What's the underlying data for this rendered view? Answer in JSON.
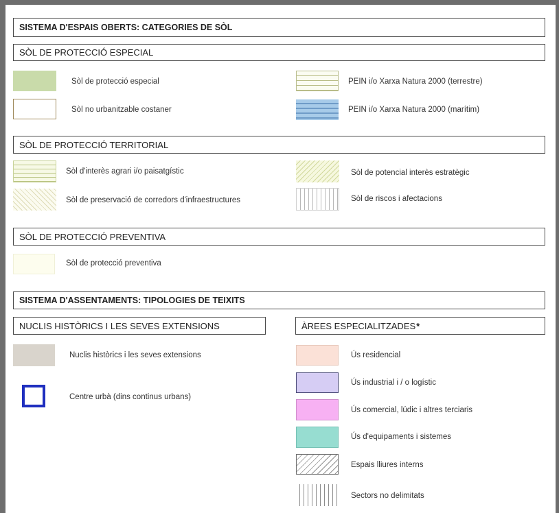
{
  "sections": {
    "espais_oberts": {
      "title": "SISTEMA D'ESPAIS OBERTS: CATEGORIES DE SÒL"
    },
    "proteccio_especial": {
      "title": "SÒL DE PROTECCIÓ ESPECIAL",
      "items": [
        {
          "label": "Sòl de protecció especial",
          "swatch": "solid-green",
          "color": "#c9dbaa"
        },
        {
          "label": "Sòl no urbanitzable costaner",
          "swatch": "outlined-box",
          "color": "#a08a5c"
        },
        {
          "label": "PEIN i/o Xarxa Natura 2000 (terrestre)",
          "swatch": "horizontal-lines",
          "color": "#b8bc85"
        },
        {
          "label": "PEIN i/o Xarxa Natura 2000 (marítim)",
          "swatch": "blue-horizontal-lines",
          "color": "#a7cbe9"
        }
      ]
    },
    "proteccio_territorial": {
      "title": "SÒL DE PROTECCIÓ TERRITORIAL",
      "items": [
        {
          "label": "Sòl d'interès agrari i/o paisatgístic",
          "swatch": "horizontal-lines",
          "color": "#b9c481"
        },
        {
          "label": "Sòl de preservació de corredors d'infraestructures",
          "swatch": "diagonal-hatch",
          "color": "#dedbb6"
        },
        {
          "label": "Sòl de potencial interès estratègic",
          "swatch": "diagonal-hatch",
          "color": "#d1d89c"
        },
        {
          "label": "Sòl de riscos i afectacions",
          "swatch": "vertical-lines",
          "color": "#b8b8b8"
        }
      ]
    },
    "proteccio_preventiva": {
      "title": "SÒL DE PROTECCIÓ PREVENTIVA",
      "items": [
        {
          "label": "Sòl de protecció preventiva",
          "swatch": "pale-yellow",
          "color": "#fdfdee"
        }
      ]
    },
    "assentaments": {
      "title": "SISTEMA D'ASSENTAMENTS: TIPOLOGIES DE TEIXITS"
    },
    "nuclis": {
      "title": "NUCLIS HISTÒRICS I LES SEVES EXTENSIONS",
      "items": [
        {
          "label": "Nuclis històrics i les seves extensions",
          "swatch": "solid-grey",
          "color": "#d9d4cc"
        },
        {
          "label": "Centre urbà (dins continus urbans)",
          "swatch": "blue-square-outline",
          "color": "#1f2fbf"
        }
      ]
    },
    "arees": {
      "title": "ÀREES ESPECIALITZADES",
      "title_mark": "*",
      "items": [
        {
          "label": "Ús residencial",
          "swatch": "solid-peach",
          "color": "#fbe1d7"
        },
        {
          "label": "Ús industrial i / o logístic",
          "swatch": "solid-lavender",
          "color": "#d6cdf4"
        },
        {
          "label": "Ús comercial, lúdic i altres terciaris",
          "swatch": "solid-pink",
          "color": "#f7b1f3"
        },
        {
          "label": "Ús d'equipaments i sistemes",
          "swatch": "solid-teal",
          "color": "#97ddd1"
        },
        {
          "label": "Espais lliures interns",
          "swatch": "diagonal-hatch",
          "color": "#8f8f8f"
        },
        {
          "label": "Sectors no delimitats",
          "swatch": "vertical-lines",
          "color": "#8c8c8c"
        }
      ]
    }
  }
}
